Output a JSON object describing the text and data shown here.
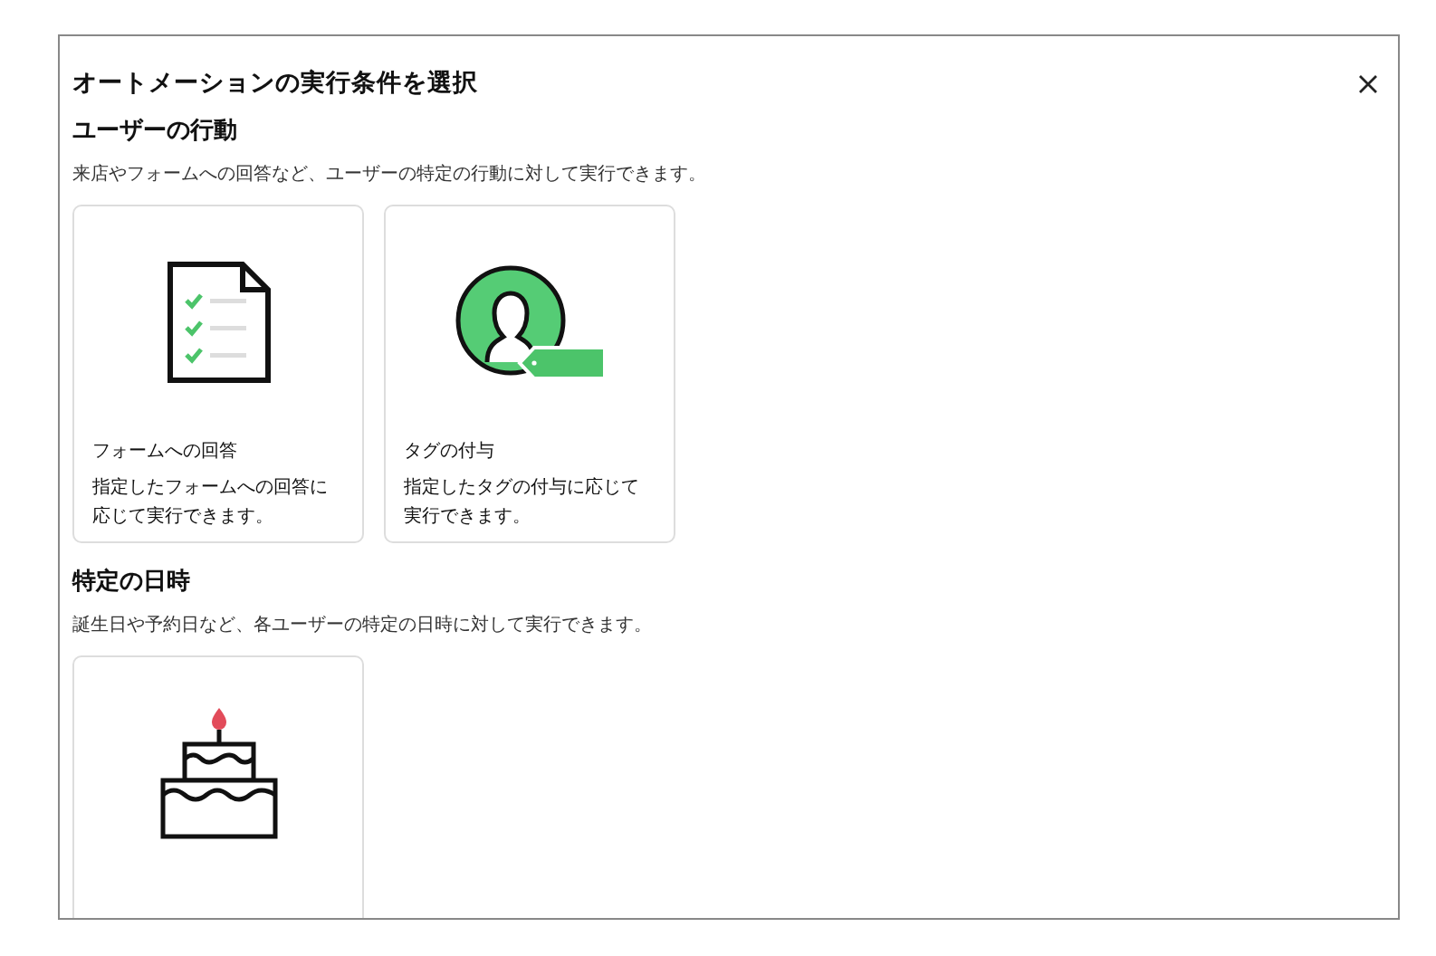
{
  "dialog": {
    "title": "オートメーションの実行条件を選択"
  },
  "sections": [
    {
      "heading": "ユーザーの行動",
      "description": "来店やフォームへの回答など、ユーザーの特定の行動に対して実行できます。",
      "cards": [
        {
          "kind": "form",
          "label": "フォームへの回答",
          "description": "指定したフォームへの回答に応じて実行できます。"
        },
        {
          "kind": "tag",
          "label": "タグの付与",
          "description": "指定したタグの付与に応じて実行できます。"
        }
      ]
    },
    {
      "heading": "特定の日時",
      "description": "誕生日や予約日など、各ユーザーの特定の日時に対して実行できます。",
      "cards": [
        {
          "kind": "cake"
        }
      ]
    }
  ]
}
